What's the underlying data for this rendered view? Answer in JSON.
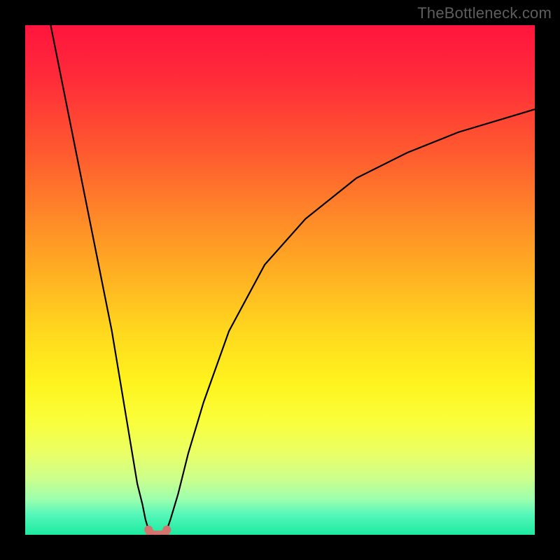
{
  "watermark": "TheBottleneck.com",
  "colors": {
    "frame": "#000000",
    "curve": "#000000",
    "dots": "#d4746e"
  },
  "chart_data": {
    "type": "line",
    "title": "",
    "xlabel": "",
    "ylabel": "",
    "xlim": [
      0,
      100
    ],
    "ylim": [
      0,
      100
    ],
    "series": [
      {
        "name": "left-branch",
        "x": [
          5,
          8,
          11,
          14,
          17,
          19.5,
          21,
          22,
          23,
          23.6,
          24.2
        ],
        "y": [
          100,
          85,
          70,
          55,
          40,
          25,
          16,
          10,
          6,
          3,
          1
        ]
      },
      {
        "name": "right-branch",
        "x": [
          27.8,
          28.5,
          30,
          32,
          35,
          40,
          47,
          55,
          65,
          75,
          85,
          95,
          100
        ],
        "y": [
          1,
          3,
          8,
          16,
          26,
          40,
          53,
          62,
          70,
          75,
          79,
          82,
          83.5
        ]
      },
      {
        "name": "floor-dots",
        "x": [
          24.2,
          24.5,
          25,
          25.5,
          25.9,
          26.1,
          26.5,
          27,
          27.5,
          27.8
        ],
        "y": [
          1,
          0.4,
          0,
          0,
          0,
          0,
          0,
          0,
          0.4,
          1
        ]
      }
    ]
  }
}
